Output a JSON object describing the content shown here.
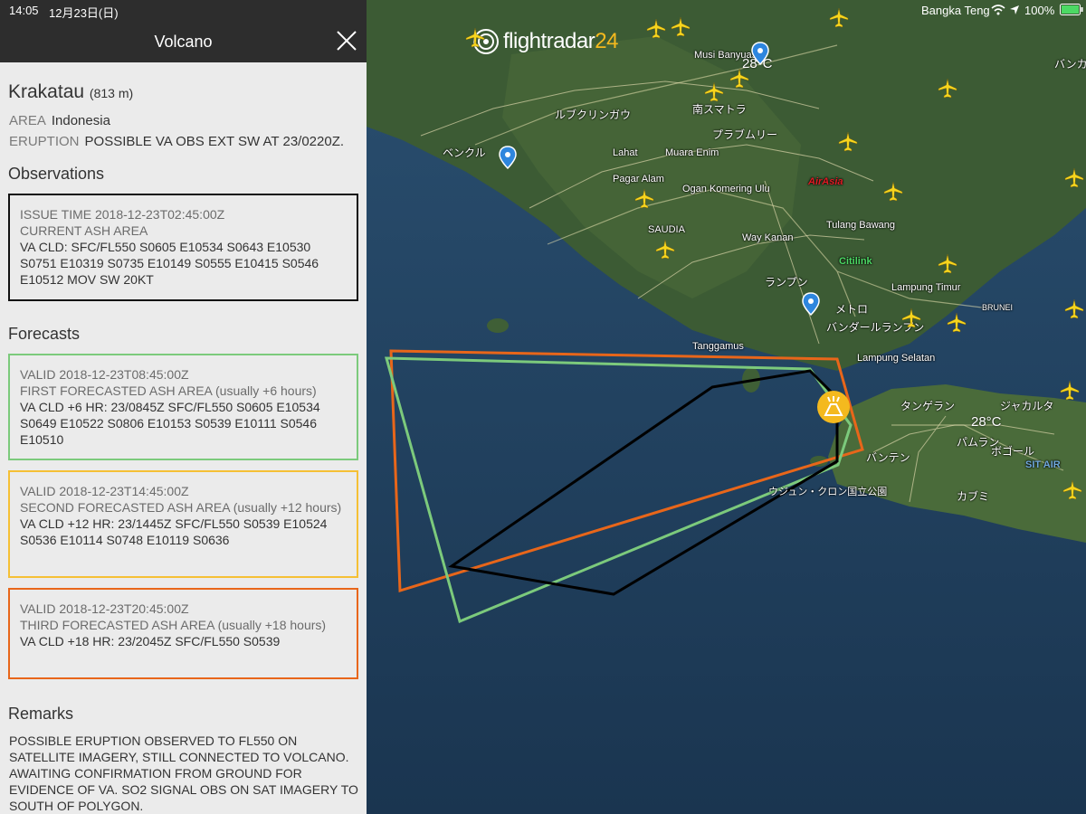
{
  "status_bar": {
    "time": "14:05",
    "date": "12月23日(日)",
    "carrier": "Bangka Teng",
    "battery": "100%"
  },
  "panel": {
    "title": "Volcano",
    "close_icon": "close-icon",
    "volcano": {
      "name": "Krakatau",
      "elevation": "(813 m)",
      "area_label": "AREA",
      "area_value": "Indonesia",
      "eruption_label": "ERUPTION",
      "eruption_value": "POSSIBLE VA OBS EXT SW AT 23/0220Z."
    },
    "observations": {
      "heading": "Observations",
      "issue_time": "ISSUE TIME 2018-12-23T02:45:00Z",
      "area_title": "CURRENT ASH AREA",
      "body": "VA CLD: SFC/FL550 S0605 E10534 S0643 E10530 S0751 E10319 S0735 E10149 S0555 E10415 S0546 E10512 MOV SW 20KT"
    },
    "forecasts": {
      "heading": "Forecasts",
      "items": [
        {
          "valid": "VALID 2018-12-23T08:45:00Z",
          "title": "FIRST FORECASTED ASH AREA (usually +6 hours)",
          "body": "VA CLD +6 HR: 23/0845Z SFC/FL550 S0605 E10534 S0649 E10522 S0806 E10153 S0539 E10111 S0546 E10510",
          "color": "#7cca7c"
        },
        {
          "valid": "VALID 2018-12-23T14:45:00Z",
          "title": "SECOND FORECASTED ASH AREA (usually +12 hours)",
          "body": "VA CLD +12 HR: 23/1445Z SFC/FL550 S0539 E10524 S0536 E10114 S0748 E10119 S0636",
          "color": "#f5c035"
        },
        {
          "valid": "VALID 2018-12-23T20:45:00Z",
          "title": "THIRD FORECASTED ASH AREA (usually +18 hours)",
          "body": "VA CLD +18 HR: 23/2045Z SFC/FL550 S0539",
          "color": "#e8661a"
        }
      ]
    },
    "remarks": {
      "heading": "Remarks",
      "body": "POSSIBLE ERUPTION OBSERVED TO FL550 ON SATELLITE IMAGERY, STILL CONNECTED TO VOLCANO. AWAITING CONFIRMATION FROM GROUND FOR EVIDENCE OF VA. SO2 SIGNAL OBS ON SAT IMAGERY TO SOUTH OF POLYGON."
    }
  },
  "map": {
    "logo_text": "flightradar",
    "logo_number": "24",
    "weather": [
      "28°C",
      "28°C"
    ],
    "places": [
      {
        "name": "Musi Banyuasin"
      },
      {
        "name": "南スマトラ"
      },
      {
        "name": "ルブクリンガウ"
      },
      {
        "name": "プラブムリー"
      },
      {
        "name": "ベンクル"
      },
      {
        "name": "Lahat"
      },
      {
        "name": "Muara Enim"
      },
      {
        "name": "Pagar Alam"
      },
      {
        "name": "Ogan Komering Ulu"
      },
      {
        "name": "SAUDIA"
      },
      {
        "name": "Way Kanan"
      },
      {
        "name": "Tulang Bawang"
      },
      {
        "name": "ランプン"
      },
      {
        "name": "Lampung Timur"
      },
      {
        "name": "メトロ"
      },
      {
        "name": "バンダールランプン"
      },
      {
        "name": "Tanggamus"
      },
      {
        "name": "Lampung Selatan"
      },
      {
        "name": "タンゲラン"
      },
      {
        "name": "ジャカルタ"
      },
      {
        "name": "パムラン"
      },
      {
        "name": "ボゴール"
      },
      {
        "name": "バンテン"
      },
      {
        "name": "カブミ"
      },
      {
        "name": "ウジュン・クロン国立公園"
      },
      {
        "name": "バンカ"
      },
      {
        "name": "Citilink"
      },
      {
        "name": "AirAsia"
      },
      {
        "name": "BRUNEI"
      },
      {
        "name": "SIT AIR"
      }
    ],
    "colors": {
      "current_ash": "#000000",
      "forecast_6h": "#7cca7c",
      "forecast_12h": "#f5c035",
      "forecast_18h": "#e8661a"
    },
    "icons": [
      "airplane-icon",
      "location-pin-icon",
      "volcano-icon",
      "wifi-icon",
      "battery-icon"
    ]
  }
}
